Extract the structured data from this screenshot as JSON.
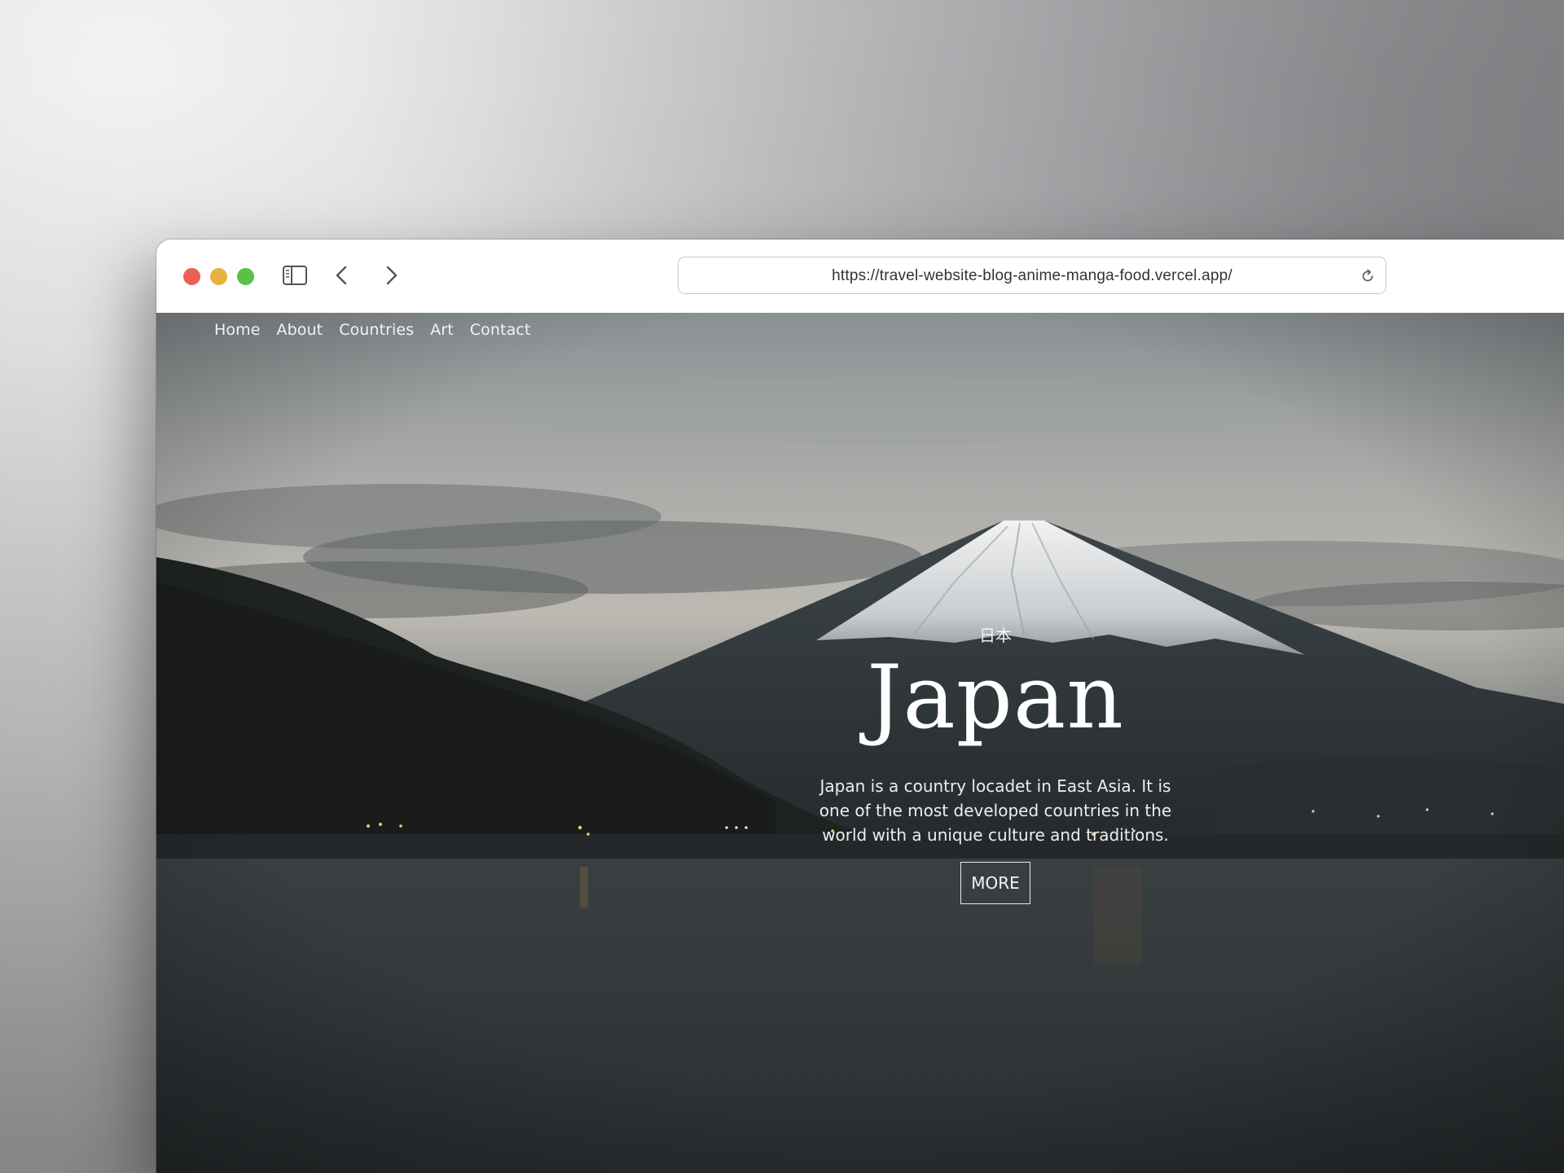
{
  "browser": {
    "url": "https://travel-website-blog-anime-manga-food.vercel.app/",
    "icons": {
      "close": "close-window-icon",
      "minimize": "minimize-window-icon",
      "maximize": "maximize-window-icon",
      "sidebar": "sidebar-toggle-icon",
      "back": "chevron-left-icon",
      "forward": "chevron-right-icon",
      "reload": "reload-icon"
    },
    "colors": {
      "close": "#ec5f57",
      "minimize": "#e9b23d",
      "maximize": "#5cbf49"
    }
  },
  "site": {
    "nav": [
      {
        "label": "Home"
      },
      {
        "label": "About"
      },
      {
        "label": "Countries"
      },
      {
        "label": "Art"
      },
      {
        "label": "Contact"
      }
    ],
    "hero": {
      "subtitle": "日本",
      "title": "Japan",
      "description": "Japan is a country locadet in East Asia. It is one of the most developed countries in the world with a unique culture and traditions.",
      "button_label": "MORE"
    }
  }
}
